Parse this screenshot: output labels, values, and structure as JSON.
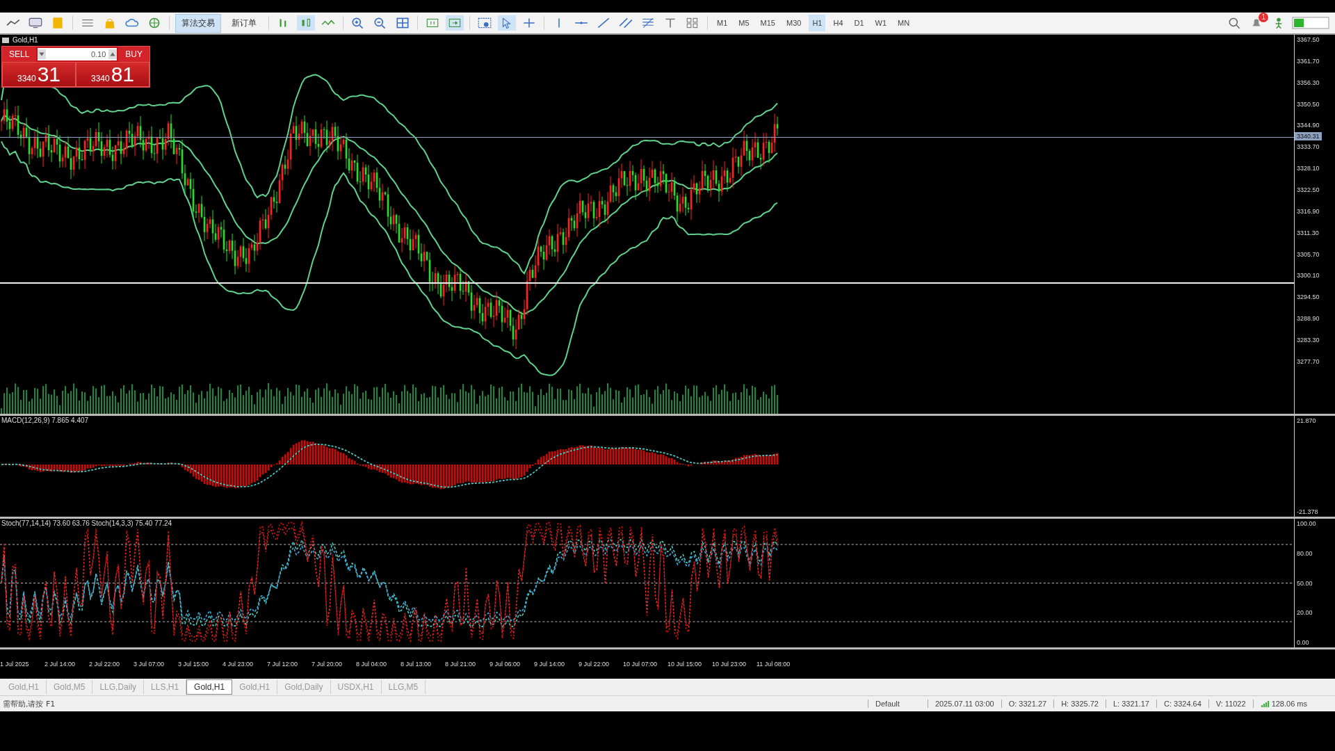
{
  "toolbar": {
    "buttons": [
      {
        "label": "算法交易",
        "selected": true
      },
      {
        "label": "新订单",
        "selected": false
      }
    ],
    "timeframes": [
      {
        "label": "M1",
        "selected": false
      },
      {
        "label": "M5",
        "selected": false
      },
      {
        "label": "M15",
        "selected": false
      },
      {
        "label": "M30",
        "selected": false
      },
      {
        "label": "H1",
        "selected": true
      },
      {
        "label": "H4",
        "selected": false
      },
      {
        "label": "D1",
        "selected": false
      },
      {
        "label": "W1",
        "selected": false
      },
      {
        "label": "MN",
        "selected": false
      }
    ],
    "notification_count": "1"
  },
  "chart": {
    "title": "Gold,H1",
    "trade_panel": {
      "sell": "SELL",
      "buy": "BUY",
      "volume": "0.10",
      "bid_big": "3340",
      "bid_small": "31",
      "ask_big": "3340",
      "ask_small": "81"
    },
    "price_axis": [
      "3367.50",
      "3361.70",
      "3356.30",
      "3350.50",
      "3344.90",
      "3333.70",
      "3328.10",
      "3322.50",
      "3316.90",
      "3311.30",
      "3305.70",
      "3300.10",
      "3294.50",
      "3288.90",
      "3283.30",
      "3277.70"
    ],
    "current_price": "3340.31",
    "macd": {
      "label": "MACD(12,26,9) 7.865 4.407",
      "axis": [
        "21.870",
        "-21.378"
      ]
    },
    "stochastic": {
      "label": "Stoch(77,14,14) 73.60 63.76 Stoch(14,3,3) 75.40 77.24",
      "axis": [
        "100.00",
        "80.00",
        "50.00",
        "20.00",
        "0.00"
      ]
    },
    "time_axis": [
      "1 Jul 2025",
      "2 Jul 14:00",
      "2 Jul 22:00",
      "3 Jul 07:00",
      "3 Jul 15:00",
      "4 Jul 23:00",
      "7 Jul 12:00",
      "7 Jul 20:00",
      "8 Jul 04:00",
      "8 Jul 13:00",
      "8 Jul 21:00",
      "9 Jul 06:00",
      "9 Jul 14:00",
      "9 Jul 22:00",
      "10 Jul 07:00",
      "10 Jul 15:00",
      "10 Jul 23:00",
      "11 Jul 08:00"
    ]
  },
  "tabs": [
    {
      "label": "Gold,H1",
      "selected": false
    },
    {
      "label": "Gold,M5",
      "selected": false
    },
    {
      "label": "LLG,Daily",
      "selected": false
    },
    {
      "label": "LLS,H1",
      "selected": false
    },
    {
      "label": "Gold,H1",
      "selected": true
    },
    {
      "label": "Gold,H1",
      "selected": false
    },
    {
      "label": "Gold,Daily",
      "selected": false
    },
    {
      "label": "USDX,H1",
      "selected": false
    },
    {
      "label": "LLG,M5",
      "selected": false
    }
  ],
  "status_bar": {
    "help": "需帮助,请按 F1",
    "profile": "Default",
    "time": "2025.07.11 03:00",
    "open": "O: 3321.27",
    "high": "H: 3325.72",
    "low": "L: 3321.17",
    "close": "C: 3324.64",
    "volume": "V: 11022",
    "ping": "128.06 ms"
  }
}
